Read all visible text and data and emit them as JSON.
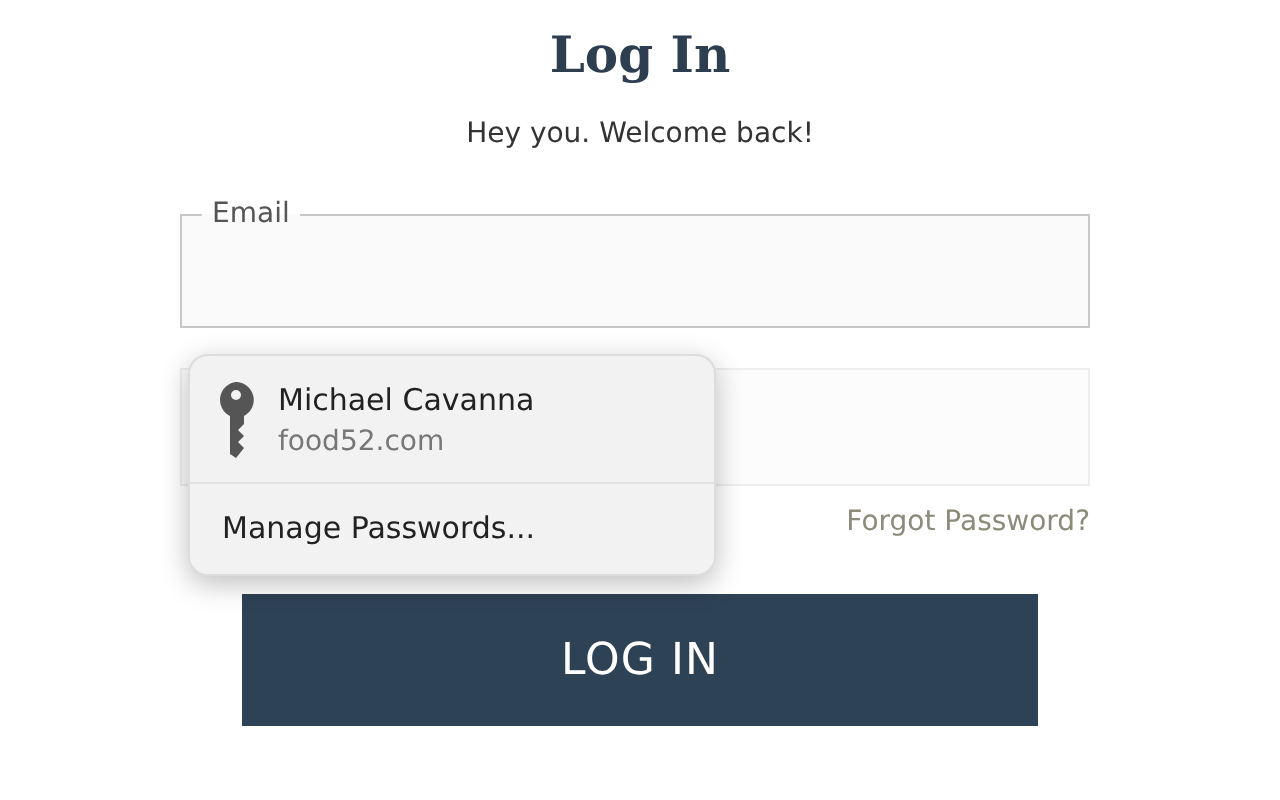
{
  "title": "Log In",
  "subtitle": "Hey you. Welcome back!",
  "email_field": {
    "label": "Email"
  },
  "password_popup": {
    "name": "Michael Cavanna",
    "site": "food52.com",
    "manage": "Manage Passwords..."
  },
  "forgot_link": "Forgot Password?",
  "login_button": "LOG IN"
}
